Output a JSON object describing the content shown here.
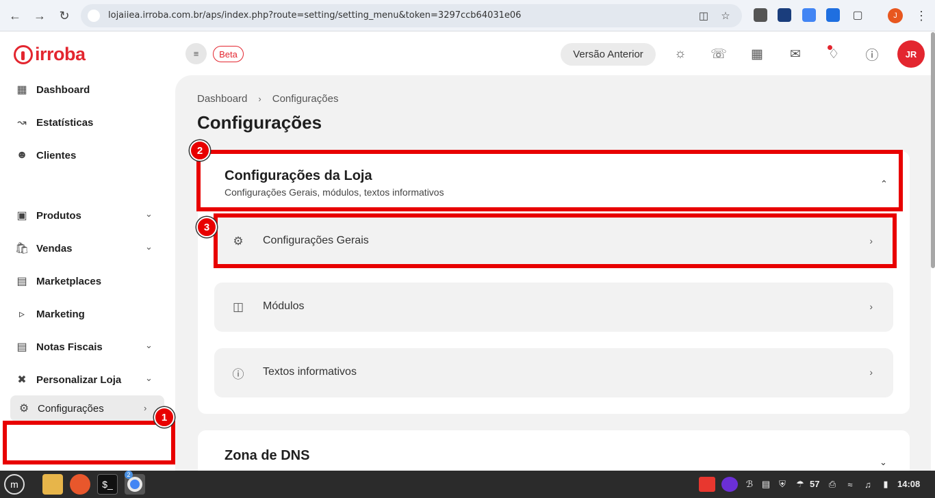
{
  "browser": {
    "url": "lojaiiea.irroba.com.br/aps/index.php?route=setting/setting_menu&token=3297ccb64031e06",
    "profile_initial": "J"
  },
  "sidebar": {
    "logo_text": "irroba",
    "items": [
      {
        "label": "Dashboard",
        "icon": "grid-icon"
      },
      {
        "label": "Estatísticas",
        "icon": "chart-icon"
      },
      {
        "label": "Clientes",
        "icon": "users-icon"
      },
      {
        "label": "Produtos",
        "icon": "box-icon"
      },
      {
        "label": "Vendas",
        "icon": "bag-icon"
      },
      {
        "label": "Marketplaces",
        "icon": "store-icon"
      },
      {
        "label": "Marketing",
        "icon": "megaphone-icon"
      },
      {
        "label": "Notas Fiscais",
        "icon": "document-icon"
      },
      {
        "label": "Personalizar Loja",
        "icon": "tools-icon"
      }
    ],
    "config_label": "Configurações"
  },
  "topbar": {
    "beta": "Beta",
    "versao_anterior": "Versão Anterior",
    "avatar_initials": "JR"
  },
  "main": {
    "breadcrumb": [
      "Dashboard",
      "Configurações"
    ],
    "title": "Configurações",
    "section1": {
      "title": "Configurações da Loja",
      "subtitle": "Configurações Gerais, módulos, textos informativos",
      "rows": [
        "Configurações Gerais",
        "Módulos",
        "Textos informativos"
      ]
    },
    "section2": {
      "title": "Zona de DNS"
    }
  },
  "annotations": [
    "1",
    "2",
    "3"
  ],
  "taskbar": {
    "chrome_badge": "2",
    "tray_number": "57",
    "time": "14:08"
  },
  "colors": {
    "brand_red": "#e3262f",
    "highlight_red": "#e80000"
  }
}
